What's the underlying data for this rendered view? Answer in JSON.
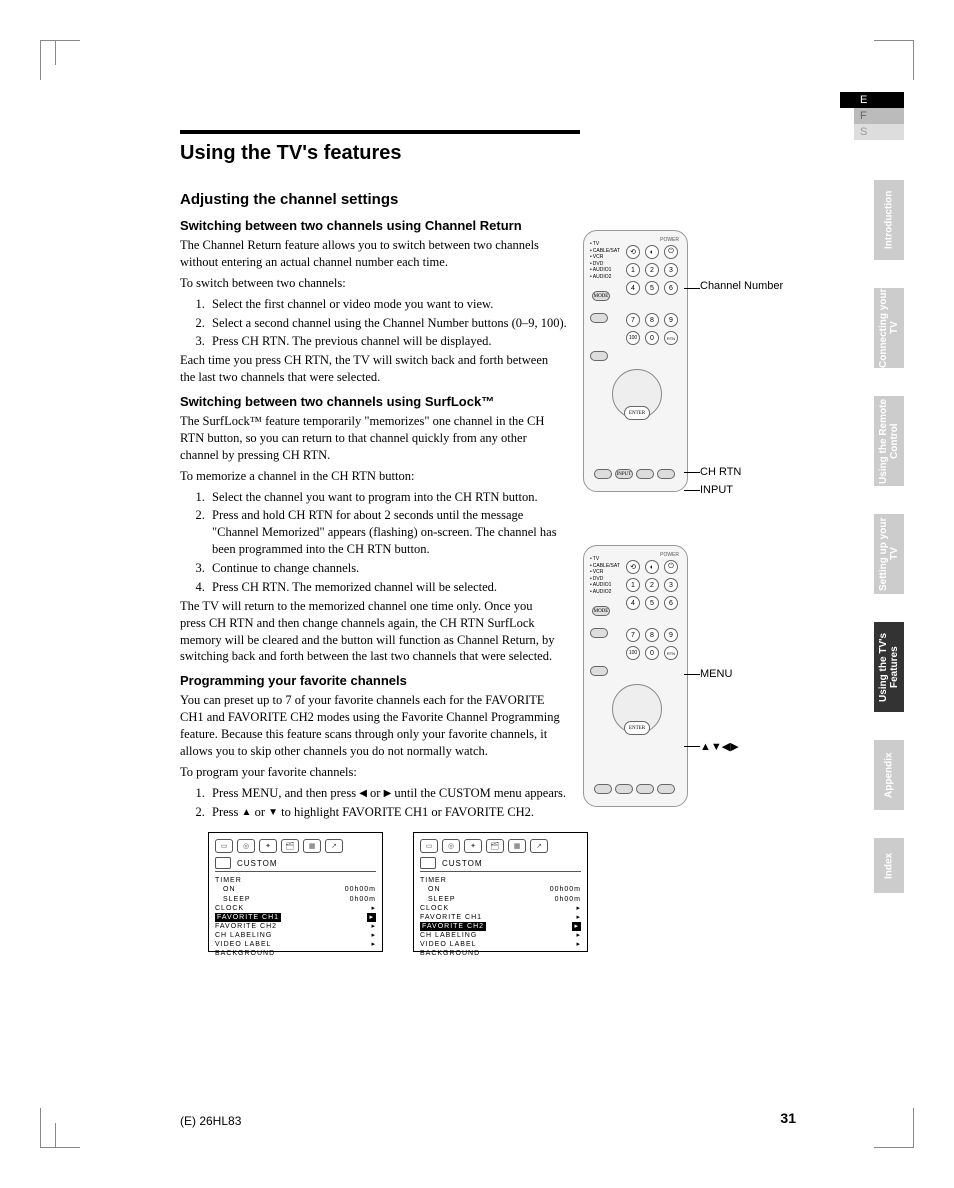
{
  "page": {
    "title": "Using the TV's features",
    "section": "Adjusting the channel settings",
    "number": "31",
    "model": "(E) 26HL83"
  },
  "lang_tabs": {
    "e": "E",
    "f": "F",
    "s": "S"
  },
  "side_tabs": {
    "intro": "Introduction",
    "connecting": "Connecting your TV",
    "remote": "Using the Remote Control",
    "setup": "Setting up your TV",
    "features": "Using the TV's Features",
    "appendix": "Appendix",
    "index": "Index"
  },
  "sub1": {
    "heading": "Switching between two channels using Channel Return",
    "p1": "The Channel Return feature allows you to switch between two channels without entering an actual channel number each time.",
    "p2": "To switch between two channels:",
    "steps": [
      "Select the first channel or video mode you want to view.",
      "Select a second channel using the Channel Number buttons (0–9, 100).",
      "Press CH RTN. The previous channel will be displayed."
    ],
    "p3": "Each time you press CH RTN, the TV will switch back and forth between the last two channels that were selected."
  },
  "sub2": {
    "heading": "Switching between two channels using SurfLock™",
    "p1": "The SurfLock™ feature temporarily \"memorizes\" one channel in the CH RTN button, so you can return to that channel quickly from any other channel by pressing CH RTN.",
    "p2": "To memorize a channel in the CH RTN button:",
    "steps": [
      "Select the channel you want to program into the CH RTN button.",
      "Press and hold CH RTN for about 2 seconds until the message \"Channel Memorized\" appears (flashing) on-screen. The channel has been programmed into the CH RTN button.",
      "Continue to change channels.",
      "Press CH RTN. The memorized channel will be selected."
    ],
    "p3": "The TV will return to the memorized channel one time only. Once you press CH RTN and then change channels again, the CH RTN SurfLock memory will be cleared and the button will function as Channel Return, by switching back and forth between the last two channels that were selected."
  },
  "sub3": {
    "heading": "Programming your favorite channels",
    "p1": "You can preset up to 7 of your favorite channels each for the FAVORITE CH1 and FAVORITE CH2 modes using the Favorite Channel Programming feature. Because this feature scans through only your favorite channels, it allows you to skip other channels you do not normally watch.",
    "p2": "To program your favorite channels:",
    "step1a": "Press MENU, and then press ",
    "step1b": " or ",
    "step1c": " until the CUSTOM menu appears.",
    "step2a": "Press ",
    "step2b": " or ",
    "step2c": " to highlight FAVORITE CH1 or FAVORITE CH2."
  },
  "remote": {
    "modes": [
      "TV",
      "CABLE/SAT",
      "VCR",
      "DVD",
      "AUDIO1",
      "AUDIO2"
    ],
    "power": "POWER",
    "mode_btn": "MODE",
    "enter": "ENTER",
    "callout_channel": "Channel Number",
    "callout_chrtn": "CH RTN",
    "callout_input": "INPUT",
    "callout_menu": "MENU",
    "callout_arrows": "▲▼◀▶"
  },
  "osd": {
    "title": "CUSTOM",
    "items": {
      "timer": "TIMER",
      "on": "ON",
      "on_val": "00h00m",
      "sleep": "SLEEP",
      "sleep_val": "0h00m",
      "clock": "CLOCK",
      "fav1": "FAVORITE CH1",
      "fav2": "FAVORITE CH2",
      "chlabel": "CH LABELING",
      "vidlabel": "VIDEO LABEL",
      "bg": "BACKGROUND"
    }
  }
}
